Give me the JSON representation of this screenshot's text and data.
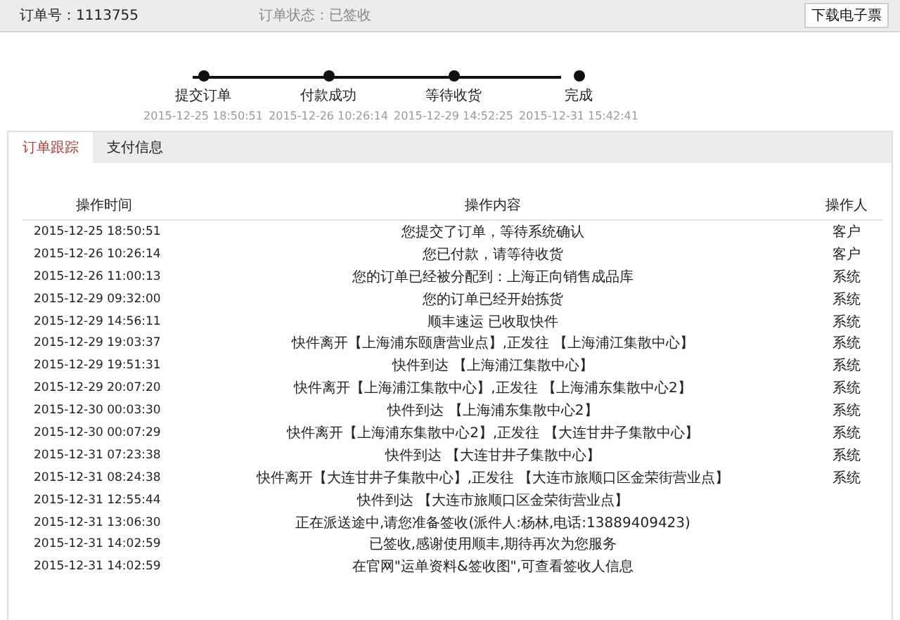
{
  "header": {
    "order_number": "订单号：1113755",
    "order_status": "订单状态：已签收",
    "download_button": "下载电子票"
  },
  "progress": [
    {
      "label": "提交订单",
      "time": "2015-12-25 18:50:51"
    },
    {
      "label": "付款成功",
      "time": "2015-12-26 10:26:14"
    },
    {
      "label": "等待收货",
      "time": "2015-12-29 14:52:25"
    },
    {
      "label": "完成",
      "time": "2015-12-31 15:42:41"
    }
  ],
  "tabs": [
    {
      "label": "订单跟踪",
      "selected": true
    },
    {
      "label": "支付信息",
      "selected": false
    }
  ],
  "table": {
    "columns": [
      "操作时间",
      "操作内容",
      "操作人"
    ],
    "rows": [
      {
        "time": "2015-12-25 18:50:51",
        "content": "您提交了订单，等待系统确认",
        "operator": "客户"
      },
      {
        "time": "2015-12-26 10:26:14",
        "content": "您已付款，请等待收货",
        "operator": "客户"
      },
      {
        "time": "2015-12-26 11:00:13",
        "content": "您的订单已经被分配到：上海正向销售成品库",
        "operator": "系统"
      },
      {
        "time": "2015-12-29 09:32:00",
        "content": "您的订单已经开始拣货",
        "operator": "系统"
      },
      {
        "time": "2015-12-29 14:56:11",
        "content": "顺丰速运 已收取快件",
        "operator": "系统"
      },
      {
        "time": "2015-12-29 19:03:37",
        "content": "快件离开【上海浦东颐唐营业点】,正发往 【上海浦江集散中心】",
        "operator": "系统"
      },
      {
        "time": "2015-12-29 19:51:31",
        "content": "快件到达 【上海浦江集散中心】",
        "operator": "系统"
      },
      {
        "time": "2015-12-29 20:07:20",
        "content": "快件离开【上海浦江集散中心】,正发往 【上海浦东集散中心2】",
        "operator": "系统"
      },
      {
        "time": "2015-12-30 00:03:30",
        "content": "快件到达 【上海浦东集散中心2】",
        "operator": "系统"
      },
      {
        "time": "2015-12-30 00:07:29",
        "content": "快件离开【上海浦东集散中心2】,正发往 【大连甘井子集散中心】",
        "operator": "系统"
      },
      {
        "time": "2015-12-31 07:23:38",
        "content": "快件到达 【大连甘井子集散中心】",
        "operator": "系统"
      },
      {
        "time": "2015-12-31 08:24:38",
        "content": "快件离开【大连甘井子集散中心】,正发往 【大连市旅顺口区金荣街营业点】",
        "operator": "系统"
      },
      {
        "time": "2015-12-31 12:55:44",
        "content": "快件到达 【大连市旅顺口区金荣街营业点】"
      },
      {
        "time": "2015-12-31 13:06:30",
        "content": "正在派送途中,请您准备签收(派件人:杨林,电话:13889409423)"
      },
      {
        "time": "2015-12-31 14:02:59",
        "content": "已签收,感谢使用顺丰,期待再次为您服务"
      },
      {
        "time": "2015-12-31 14:02:59",
        "content": "在官网\"运单资料&签收图\",可查看签收人信息"
      }
    ]
  }
}
